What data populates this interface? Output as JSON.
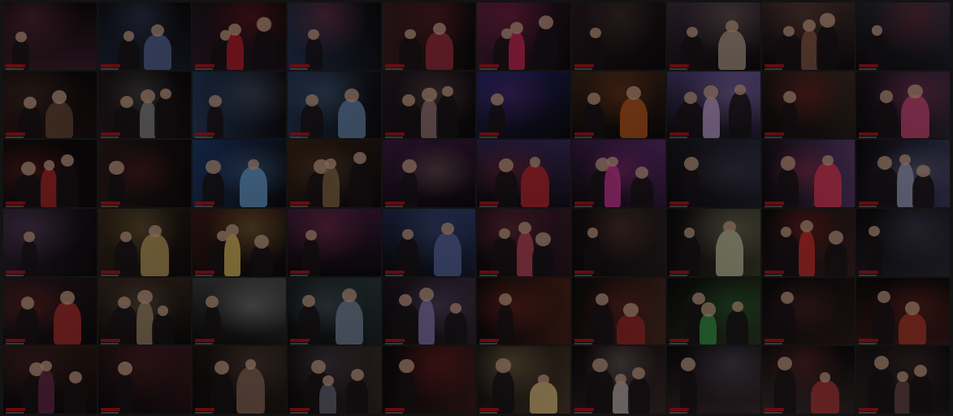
{
  "wall": {
    "columns": 10,
    "rows": 6,
    "dim_overlay": "#000000",
    "palette": [
      [
        "#3a1e2a",
        "#1d2436",
        "#2b1a24",
        "#24324d",
        "#3b1d1f",
        "#4a1f3a",
        "#2a1a1f",
        "#3a2a3a",
        "#3d2a2a",
        "#2f3140"
      ],
      [
        "#2a1614",
        "#241a1c",
        "#26395a",
        "#243754",
        "#241820",
        "#1d2460",
        "#3a2418",
        "#5a4a8a",
        "#3a2a22",
        "#3a2a40"
      ],
      [
        "#1a0f10",
        "#2a1a1a",
        "#1d3a6a",
        "#3a2416",
        "#3a1a40",
        "#3a2a5a",
        "#5a2a6a",
        "#2a2a3a",
        "#5a3a6a",
        "#3a3a5a"
      ],
      [
        "#2a2030",
        "#3a2a1a",
        "#3a1a14",
        "#3a1a3a",
        "#2a3a6a",
        "#3a1a2a",
        "#2a2020",
        "#3a3a2a",
        "#3a2020",
        "#2a2a36"
      ],
      [
        "#2a1a20",
        "#3a2a20",
        "#4a4a4a",
        "#2a3a3a",
        "#3a2a3a",
        "#4a2018",
        "#4a2a20",
        "#2a3a20",
        "#2a1a1a",
        "#3a1a1a"
      ],
      [
        "#2a1a10",
        "#3a1a20",
        "#2a2018",
        "#3a2a2a",
        "#3a1a1a",
        "#4a3a2a",
        "#3a2a2a",
        "#3a2a30",
        "#3a2a2a",
        "#2a2020"
      ]
    ],
    "accents": [
      [
        "#b04a6a",
        "#5a6a9a",
        "#c02030",
        "#d04a6a",
        "#a03040",
        "#d02a5a",
        "#6a5a4a",
        "#b09a8a",
        "#8a5a4a",
        "#b03040"
      ],
      [
        "#6a4a3a",
        "#8a8a8a",
        "#7a8aaa",
        "#6a8ab0",
        "#9a7a7a",
        "#9a3ab0",
        "#c05a20",
        "#c0a0d0",
        "#c02a2a",
        "#d04a7a"
      ],
      [
        "#b02a2a",
        "#8a2a2a",
        "#6aa0d0",
        "#8a6a4a",
        "#c0a080",
        "#c02a30",
        "#d03a9a",
        "#5a5a7a",
        "#e03a5a",
        "#a0a0c0"
      ],
      [
        "#9a6a9a",
        "#c0a060",
        "#e0c060",
        "#c04a6a",
        "#5a6aa0",
        "#c04a5a",
        "#9a5a4a",
        "#c0c0a0",
        "#d03030",
        "#6a6a8a"
      ],
      [
        "#b03030",
        "#a08a6a",
        "#d0d0d0",
        "#7a8aa0",
        "#8a7ab0",
        "#c03a2a",
        "#a02a2a",
        "#3a9a4a",
        "#8a3a3a",
        "#b03a2a"
      ],
      [
        "#6a2a4a",
        "#6a2a2a",
        "#8a6a5a",
        "#6a6a7a",
        "#c02a2a",
        "#e0c080",
        "#c0b0b0",
        "#8a8aa0",
        "#b03a3a",
        "#6a4a4a"
      ]
    ]
  }
}
